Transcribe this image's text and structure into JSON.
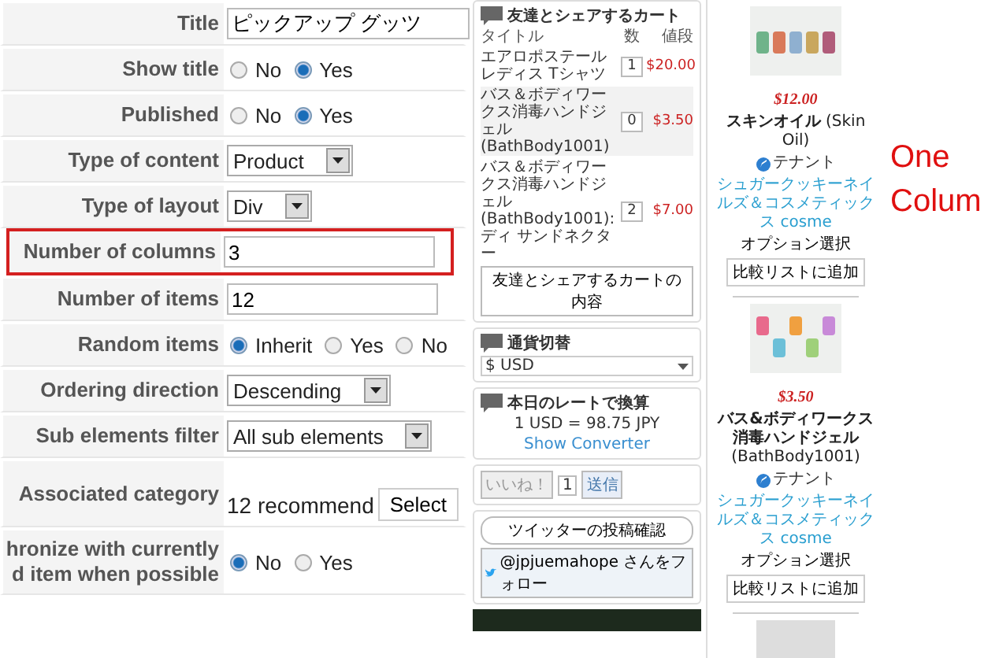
{
  "form": {
    "rows": [
      {
        "kind": "text",
        "label_lines": [
          "Title"
        ],
        "value": "ピックアップ グッツ",
        "highlighted": false
      },
      {
        "kind": "radio",
        "label_lines": [
          "Show title"
        ],
        "options": [
          {
            "label": "No",
            "selected": false
          },
          {
            "label": "Yes",
            "selected": true
          }
        ],
        "highlighted": false
      },
      {
        "kind": "radio",
        "label_lines": [
          "Published"
        ],
        "options": [
          {
            "label": "No",
            "selected": false
          },
          {
            "label": "Yes",
            "selected": true
          }
        ],
        "highlighted": false
      },
      {
        "kind": "select",
        "label_lines": [
          "Type of content"
        ],
        "value": "Product",
        "highlighted": false
      },
      {
        "kind": "select",
        "label_lines": [
          "Type of layout"
        ],
        "value": "Div",
        "highlighted": false
      },
      {
        "kind": "text",
        "label_lines": [
          "Number of columns"
        ],
        "value": "3",
        "highlighted": true
      },
      {
        "kind": "text",
        "label_lines": [
          "Number of items"
        ],
        "value": "12",
        "highlighted": false
      },
      {
        "kind": "radio",
        "label_lines": [
          "Random items"
        ],
        "options": [
          {
            "label": "Inherit",
            "selected": true
          },
          {
            "label": "Yes",
            "selected": false
          },
          {
            "label": "No",
            "selected": false
          }
        ],
        "highlighted": false
      },
      {
        "kind": "select",
        "label_lines": [
          "Ordering direction"
        ],
        "value": "Descending",
        "highlighted": false
      },
      {
        "kind": "select",
        "label_lines": [
          "Sub elements filter"
        ],
        "value": "All sub elements",
        "highlighted": false
      },
      {
        "kind": "category",
        "label_lines": [
          "Associated category"
        ],
        "value": "12 recommend",
        "button": "Select",
        "highlighted": false
      },
      {
        "kind": "radio",
        "label_lines": [
          "hronize with currently",
          "d item when possible"
        ],
        "options": [
          {
            "label": "No",
            "selected": true
          },
          {
            "label": "Yes",
            "selected": false
          }
        ],
        "highlighted": false
      }
    ]
  },
  "sidebar": {
    "widgets": [
      {
        "kind": "cart",
        "title": "友達とシェアするカート",
        "columns": [
          "タイトル",
          "数",
          "値段"
        ],
        "rows": [
          {
            "name": "エアロポステールレディス Tシャツ",
            "qty": "1",
            "price": "$20.00"
          },
          {
            "name": "バス＆ボディワークス消毒ハンドジェル (BathBody1001)",
            "qty": "0",
            "price": "$3.50"
          },
          {
            "name": "バス＆ボディワークス消毒ハンドジェル (BathBody1001): ディ サンドネクター",
            "qty": "2",
            "price": "$7.00"
          }
        ],
        "button": "友達とシェアするカートの内容"
      },
      {
        "kind": "currency",
        "title": "通貨切替",
        "value": "$ USD"
      },
      {
        "kind": "rate",
        "title": "本日のレートで換算",
        "rate": "1 USD = 98.75 JPY",
        "link": "Show Converter"
      },
      {
        "kind": "like",
        "like": "いいね！",
        "count": "1",
        "send": "送信"
      },
      {
        "kind": "twitter",
        "button": "ツイッターの投稿確認",
        "follow": "@jpjuemahope さんをフォロー"
      }
    ]
  },
  "products": [
    {
      "price": "$12.00",
      "name": "スキンオイル",
      "code": "(Skin Oil)",
      "tenant": "テナント",
      "shop": "シュガークッキーネイルズ＆コスメティックス cosme",
      "option": "オプション選択",
      "compare": "比較リストに追加"
    },
    {
      "price": "$3.50",
      "name": "バス&ボディワークス消毒ハンドジェル",
      "code": "(BathBody1001)",
      "tenant": "テナント",
      "shop": "シュガークッキーネイルズ＆コスメティックス cosme",
      "option": "オプション選択",
      "compare": "比較リストに追加"
    }
  ],
  "annotation": {
    "lines": [
      "One",
      "Colum"
    ]
  }
}
